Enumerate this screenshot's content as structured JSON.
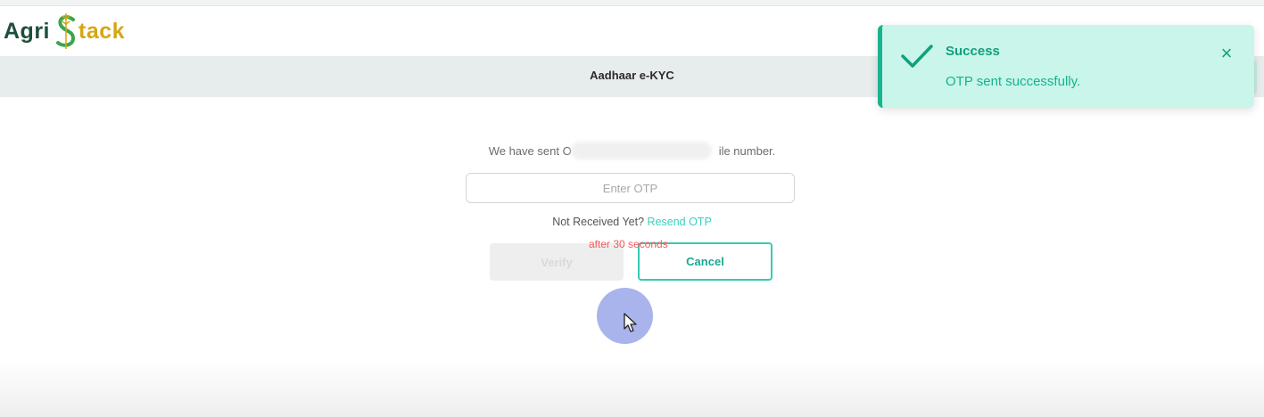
{
  "brand": {
    "part1": "Agri",
    "part2": "tack",
    "s_icon": "stylized-s-wheat-icon"
  },
  "header": {
    "title": "Aadhaar e-KYC"
  },
  "otp": {
    "sent_prefix": "We have sent O",
    "sent_suffix": "ile number.",
    "input_placeholder": "Enter OTP",
    "not_received": "Not Received Yet?",
    "resend_label": "Resend OTP",
    "timer": "after 30 seconds",
    "verify_label": "Verify",
    "cancel_label": "Cancel"
  },
  "toast": {
    "title": "Success",
    "message": "OTP sent successfully.",
    "icon": "check-icon",
    "close_glyph": "×"
  },
  "colors": {
    "accent": "#38c9b3",
    "brand_green": "#1f4f3a",
    "brand_gold": "#d7a613",
    "error": "#f05a5a",
    "toast_bg": "#c9f5ea"
  }
}
